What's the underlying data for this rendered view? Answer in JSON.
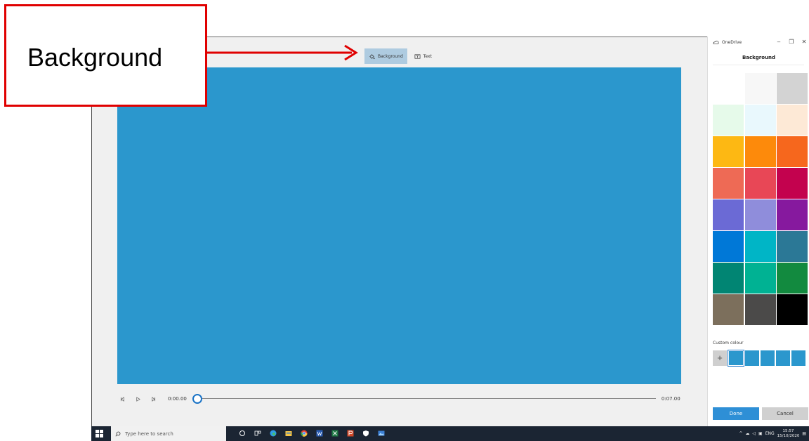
{
  "annotation": {
    "label": "Background",
    "color": "#e00000"
  },
  "toolbar": {
    "background_label": "Background",
    "text_label": "Text"
  },
  "canvas": {
    "color": "#2b97cd"
  },
  "playback": {
    "current_time": "0:00.00",
    "end_time": "0:07.00",
    "progress": 0
  },
  "panel": {
    "app_title": "OneDrive",
    "title": "Background",
    "swatches": [
      "#ffffff",
      "#f7f7f7",
      "#d3d3d3",
      "#e6faea",
      "#e9f8fd",
      "#fde9d6",
      "#fdb813",
      "#fd8a0b",
      "#f6671d",
      "#ee6a55",
      "#e84756",
      "#c3024e",
      "#6b6ad5",
      "#8f8ddb",
      "#86199e",
      "#0078d7",
      "#00b5c6",
      "#2b7896",
      "#018573",
      "#00b293",
      "#128a3f",
      "#7c6f5c",
      "#4b4a49",
      "#000000"
    ],
    "custom_label": "Custom colour",
    "custom_add_icon": "plus-icon",
    "custom_swatches": [
      "#2b97cd",
      "#2b97cd",
      "#2b97cd",
      "#2b97cd",
      "#2b97cd"
    ],
    "done_label": "Done",
    "cancel_label": "Cancel"
  },
  "taskbar": {
    "search_placeholder": "Type here to search",
    "tray_lang": "ENG",
    "time": "15:57",
    "date": "15/10/2020"
  }
}
